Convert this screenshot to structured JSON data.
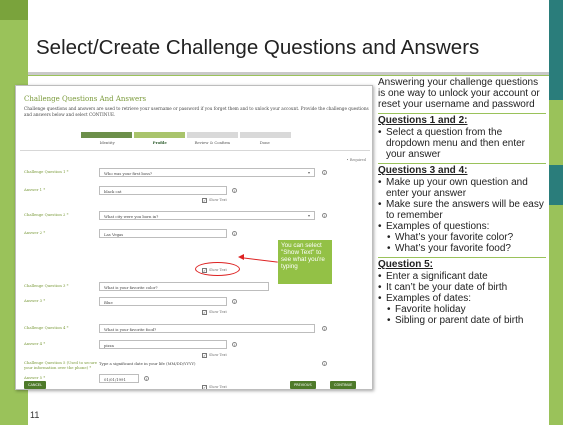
{
  "slide": {
    "title": "Select/Create Challenge Questions and Answers",
    "page_number": "11"
  },
  "screenshot": {
    "heading": "Challenge Questions And Answers",
    "description": "Challenge questions and answers are used to retrieve your username or password if you forget them and to unlock your account. Provide the challenge questions and answers below and select CONTINUE.",
    "steps": [
      "Identity",
      "Profile",
      "Review & Confirm",
      "Done"
    ],
    "active_step": "Profile",
    "required_note": "• Required",
    "rows": [
      {
        "label": "Challenge Question 1 *",
        "value": "Who was your first boss?",
        "type": "select"
      },
      {
        "label": "Answer 1 *",
        "value": "black cat"
      },
      {
        "label": "Challenge Question 2 *",
        "value": "What city were you born in?",
        "type": "select"
      },
      {
        "label": "Answer 2 *",
        "value": "Las Vegas"
      },
      {
        "label": "Challenge Question 3 *",
        "value": "What is your favorite color?",
        "type": "text"
      },
      {
        "label": "Answer 3 *",
        "value": "Blue"
      },
      {
        "label": "Challenge Question 4 *",
        "value": "What is your favorite food?",
        "type": "text"
      },
      {
        "label": "Answer 4 *",
        "value": "pizza"
      },
      {
        "label": "Challenge Question 5 (Used to secure your information over the phone) *",
        "value": "Type a significant date in your life (MM/DD/YYYY)",
        "type": "hint"
      },
      {
        "label": "Answer 5 *",
        "value": "01/01/1991"
      }
    ],
    "show_text_label": "Show Text",
    "info_glyph": "i",
    "check_glyph": "✓",
    "caret_glyph": "▾",
    "buttons": {
      "cancel": "CANCEL",
      "previous": "PREVIOUS",
      "continue": "CONTINUE"
    },
    "callout": "You can select \"Show Text\" to see what you're typing"
  },
  "panel": {
    "intro": "Answering your challenge questions is one way to unlock your account or reset your username and password",
    "sections": [
      {
        "heading": "Questions 1 and 2:",
        "items": [
          {
            "text": "Select a question from the dropdown menu and then enter your answer",
            "level": 1
          }
        ]
      },
      {
        "heading": "Questions 3 and 4:",
        "items": [
          {
            "text": "Make up your own question and enter your answer",
            "level": 1
          },
          {
            "text": "Make sure the answers will be easy to remember",
            "level": 1
          },
          {
            "text": "Examples of questions:",
            "level": 1
          },
          {
            "text": "What’s your favorite color?",
            "level": 2
          },
          {
            "text": "What’s your favorite food?",
            "level": 2
          }
        ]
      },
      {
        "heading": "Question 5:",
        "items": [
          {
            "text": "Enter a significant date",
            "level": 1
          },
          {
            "text": "It can’t be your date of birth",
            "level": 1
          },
          {
            "text": "Examples of dates:",
            "level": 1
          },
          {
            "text": "Favorite holiday",
            "level": 2
          },
          {
            "text": "Sibling or parent date of birth",
            "level": 2
          }
        ]
      }
    ]
  },
  "colors": {
    "accent_green": "#9ac25a",
    "teal": "#2a7d7b",
    "callout": "#93c146",
    "highlight_red": "#d22222"
  }
}
